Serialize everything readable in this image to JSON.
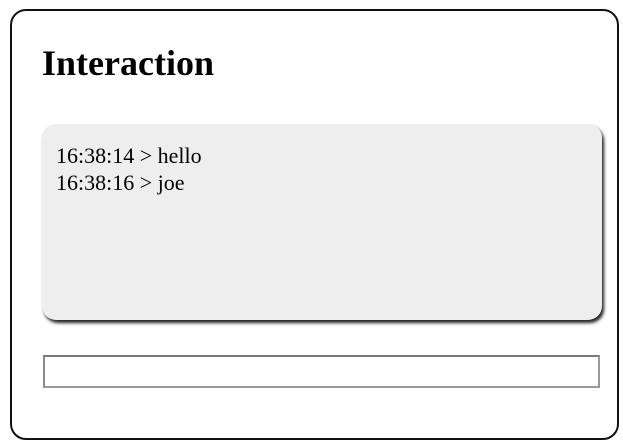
{
  "panel": {
    "title": "Interaction"
  },
  "log": {
    "lines": [
      {
        "text": "16:38:14 > hello"
      },
      {
        "text": "16:38:16 > joe"
      }
    ]
  },
  "input": {
    "value": "",
    "placeholder": ""
  }
}
